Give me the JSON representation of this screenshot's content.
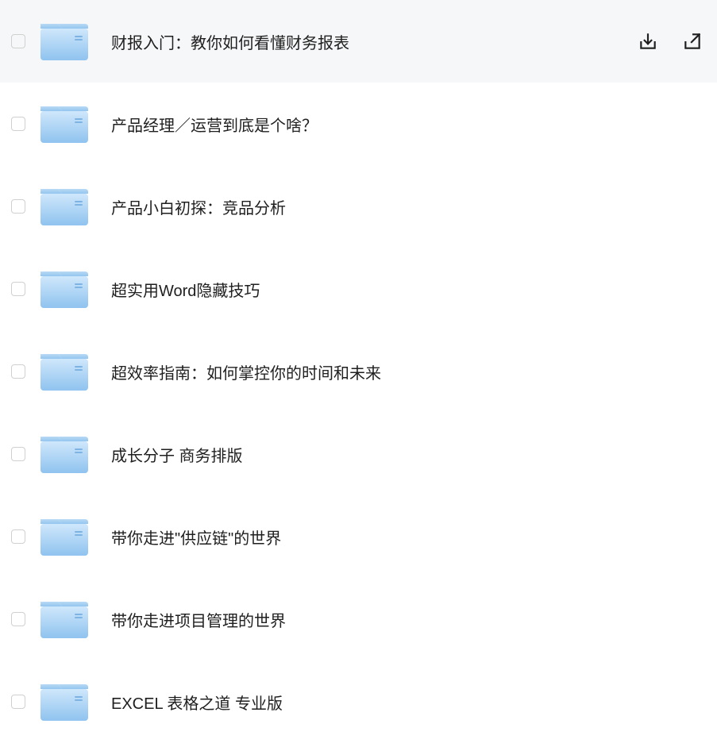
{
  "files": [
    {
      "name": "财报入门：教你如何看懂财务报表",
      "active": true
    },
    {
      "name": "产品经理／运营到底是个啥？",
      "active": false
    },
    {
      "name": "产品小白初探：竞品分析",
      "active": false
    },
    {
      "name": "超实用Word隐藏技巧",
      "active": false
    },
    {
      "name": "超效率指南：如何掌控你的时间和未来",
      "active": false
    },
    {
      "name": "成长分子 商务排版",
      "active": false
    },
    {
      "name": "带你走进\"供应链\"的世界",
      "active": false
    },
    {
      "name": "带你走进项目管理的世界",
      "active": false
    },
    {
      "name": "EXCEL 表格之道 专业版",
      "active": false
    }
  ],
  "actions": {
    "download": "download",
    "share": "share"
  }
}
